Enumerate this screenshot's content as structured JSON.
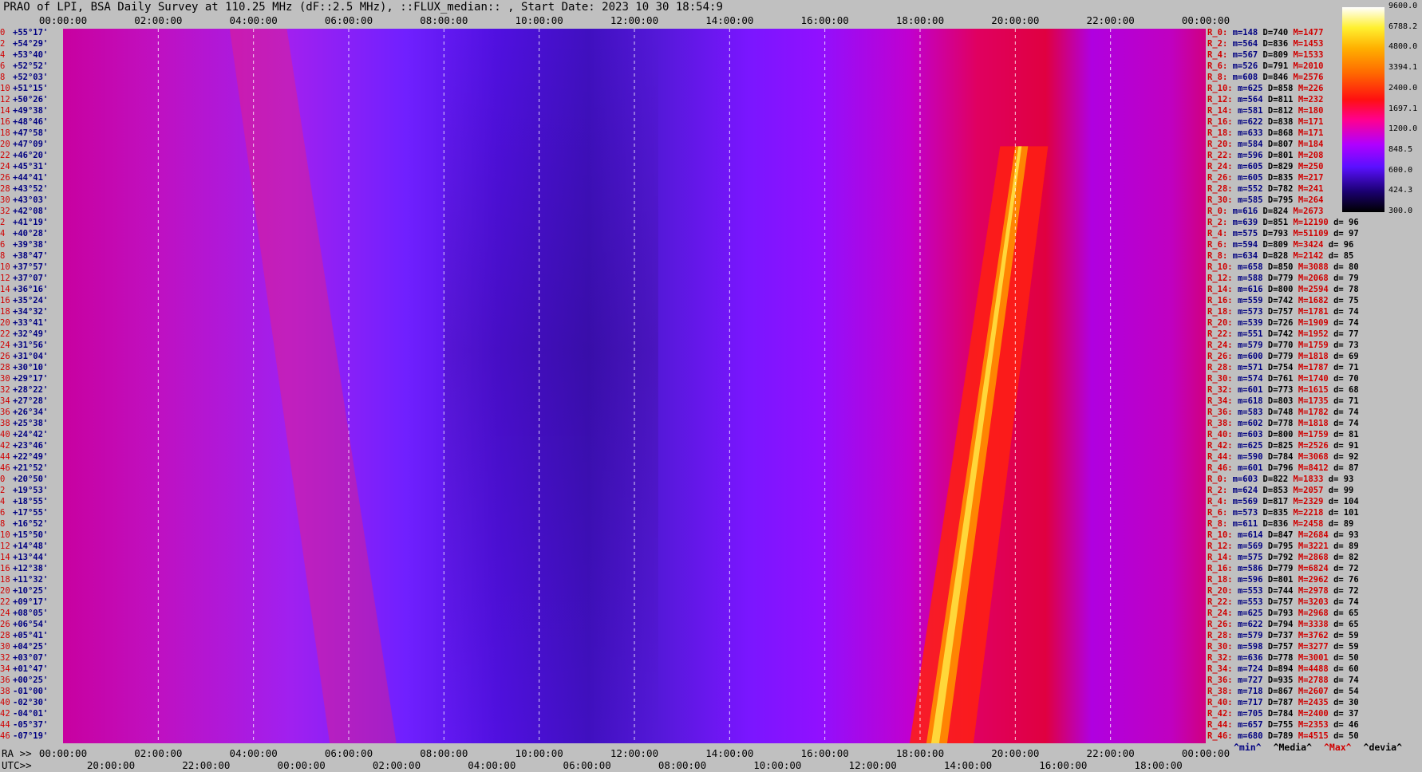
{
  "title": "PRAO of LPI, BSA Daily Survey at 110.25 MHz (dF::2.5 MHz), ::FLUX_median:: , Start Date: 2023 10 30 18:54:9",
  "bottom_prefix_1": "RA >>",
  "bottom_prefix_2": "UTC>>",
  "legend": {
    "min": "^min^",
    "media": "^Media^",
    "max": "^Max^",
    "devia": "^devia^"
  },
  "colors": {
    "min": "#000080",
    "media": "#000000",
    "max": "#d00000",
    "devia": "#000000"
  },
  "colorbar_labels": [
    "9600.0",
    "6788.2",
    "4800.0",
    "3394.1",
    "2400.0",
    "1697.1",
    "1200.0",
    "848.5",
    "600.0",
    "424.3",
    "300.0"
  ],
  "dec_labels": [
    {
      "i": "0",
      "v": "+55°17'"
    },
    {
      "i": "2",
      "v": "+54°29'"
    },
    {
      "i": "4",
      "v": "+53°40'"
    },
    {
      "i": "6",
      "v": "+52°52'"
    },
    {
      "i": "8",
      "v": "+52°03'"
    },
    {
      "i": "10",
      "v": "+51°15'"
    },
    {
      "i": "12",
      "v": "+50°26'"
    },
    {
      "i": "14",
      "v": "+49°38'"
    },
    {
      "i": "16",
      "v": "+48°46'"
    },
    {
      "i": "18",
      "v": "+47°58'"
    },
    {
      "i": "20",
      "v": "+47°09'"
    },
    {
      "i": "22",
      "v": "+46°20'"
    },
    {
      "i": "24",
      "v": "+45°31'"
    },
    {
      "i": "26",
      "v": "+44°41'"
    },
    {
      "i": "28",
      "v": "+43°52'"
    },
    {
      "i": "30",
      "v": "+43°03'"
    },
    {
      "i": "32",
      "v": "+42°08'"
    },
    {
      "i": "2",
      "v": "+41°19'"
    },
    {
      "i": "4",
      "v": "+40°28'"
    },
    {
      "i": "6",
      "v": "+39°38'"
    },
    {
      "i": "8",
      "v": "+38°47'"
    },
    {
      "i": "10",
      "v": "+37°57'"
    },
    {
      "i": "12",
      "v": "+37°07'"
    },
    {
      "i": "14",
      "v": "+36°16'"
    },
    {
      "i": "16",
      "v": "+35°24'"
    },
    {
      "i": "18",
      "v": "+34°32'"
    },
    {
      "i": "20",
      "v": "+33°41'"
    },
    {
      "i": "22",
      "v": "+32°49'"
    },
    {
      "i": "24",
      "v": "+31°56'"
    },
    {
      "i": "26",
      "v": "+31°04'"
    },
    {
      "i": "28",
      "v": "+30°10'"
    },
    {
      "i": "30",
      "v": "+29°17'"
    },
    {
      "i": "32",
      "v": "+28°22'"
    },
    {
      "i": "34",
      "v": "+27°28'"
    },
    {
      "i": "36",
      "v": "+26°34'"
    },
    {
      "i": "38",
      "v": "+25°38'"
    },
    {
      "i": "40",
      "v": "+24°42'"
    },
    {
      "i": "42",
      "v": "+23°46'"
    },
    {
      "i": "44",
      "v": "+22°49'"
    },
    {
      "i": "46",
      "v": "+21°52'"
    },
    {
      "i": "0",
      "v": "+20°50'"
    },
    {
      "i": "2",
      "v": "+19°53'"
    },
    {
      "i": "4",
      "v": "+18°55'"
    },
    {
      "i": "6",
      "v": "+17°55'"
    },
    {
      "i": "8",
      "v": "+16°52'"
    },
    {
      "i": "10",
      "v": "+15°50'"
    },
    {
      "i": "12",
      "v": "+14°48'"
    },
    {
      "i": "14",
      "v": "+13°44'"
    },
    {
      "i": "16",
      "v": "+12°38'"
    },
    {
      "i": "18",
      "v": "+11°32'"
    },
    {
      "i": "20",
      "v": "+10°25'"
    },
    {
      "i": "22",
      "v": "+09°17'"
    },
    {
      "i": "24",
      "v": "+08°05'"
    },
    {
      "i": "26",
      "v": "+06°54'"
    },
    {
      "i": "28",
      "v": "+05°41'"
    },
    {
      "i": "30",
      "v": "+04°25'"
    },
    {
      "i": "32",
      "v": "+03°07'"
    },
    {
      "i": "34",
      "v": "+01°47'"
    },
    {
      "i": "36",
      "v": "+00°25'"
    },
    {
      "i": "38",
      "v": "-01°00'"
    },
    {
      "i": "40",
      "v": "-02°30'"
    },
    {
      "i": "42",
      "v": "-04°01'"
    },
    {
      "i": "44",
      "v": "-05°37'"
    },
    {
      "i": "46",
      "v": "-07°19'"
    }
  ],
  "row_stats": [
    [
      "R_0:",
      "m=148",
      "D=740",
      "M=1477",
      ""
    ],
    [
      "R_2:",
      "m=564",
      "D=836",
      "M=1453",
      ""
    ],
    [
      "R_4:",
      "m=567",
      "D=809",
      "M=1533",
      ""
    ],
    [
      "R_6:",
      "m=526",
      "D=791",
      "M=2010",
      ""
    ],
    [
      "R_8:",
      "m=608",
      "D=846",
      "M=2576",
      ""
    ],
    [
      "R_10:",
      "m=625",
      "D=858",
      "M=226",
      ""
    ],
    [
      "R_12:",
      "m=564",
      "D=811",
      "M=232",
      ""
    ],
    [
      "R_14:",
      "m=581",
      "D=812",
      "M=180",
      ""
    ],
    [
      "R_16:",
      "m=622",
      "D=838",
      "M=171",
      ""
    ],
    [
      "R_18:",
      "m=633",
      "D=868",
      "M=171",
      ""
    ],
    [
      "R_20:",
      "m=584",
      "D=807",
      "M=184",
      ""
    ],
    [
      "R_22:",
      "m=596",
      "D=801",
      "M=208",
      ""
    ],
    [
      "R_24:",
      "m=605",
      "D=829",
      "M=250",
      ""
    ],
    [
      "R_26:",
      "m=605",
      "D=835",
      "M=217",
      ""
    ],
    [
      "R_28:",
      "m=552",
      "D=782",
      "M=241",
      ""
    ],
    [
      "R_30:",
      "m=585",
      "D=795",
      "M=264",
      ""
    ],
    [
      "R_0:",
      "m=616",
      "D=824",
      "M=2673",
      ""
    ],
    [
      "R_2:",
      "m=639",
      "D=851",
      "M=12190",
      "d= 96"
    ],
    [
      "R_4:",
      "m=575",
      "D=793",
      "M=51109",
      "d= 97"
    ],
    [
      "R_6:",
      "m=594",
      "D=809",
      "M=3424",
      "d= 96"
    ],
    [
      "R_8:",
      "m=634",
      "D=828",
      "M=2142",
      "d= 85"
    ],
    [
      "R_10:",
      "m=658",
      "D=850",
      "M=3088",
      "d= 80"
    ],
    [
      "R_12:",
      "m=588",
      "D=779",
      "M=2068",
      "d= 79"
    ],
    [
      "R_14:",
      "m=616",
      "D=800",
      "M=2594",
      "d= 78"
    ],
    [
      "R_16:",
      "m=559",
      "D=742",
      "M=1682",
      "d= 75"
    ],
    [
      "R_18:",
      "m=573",
      "D=757",
      "M=1781",
      "d= 74"
    ],
    [
      "R_20:",
      "m=539",
      "D=726",
      "M=1909",
      "d= 74"
    ],
    [
      "R_22:",
      "m=551",
      "D=742",
      "M=1952",
      "d= 77"
    ],
    [
      "R_24:",
      "m=579",
      "D=770",
      "M=1759",
      "d= 73"
    ],
    [
      "R_26:",
      "m=600",
      "D=779",
      "M=1818",
      "d= 69"
    ],
    [
      "R_28:",
      "m=571",
      "D=754",
      "M=1787",
      "d= 71"
    ],
    [
      "R_30:",
      "m=574",
      "D=761",
      "M=1740",
      "d= 70"
    ],
    [
      "R_32:",
      "m=601",
      "D=773",
      "M=1615",
      "d= 68"
    ],
    [
      "R_34:",
      "m=618",
      "D=803",
      "M=1735",
      "d= 71"
    ],
    [
      "R_36:",
      "m=583",
      "D=748",
      "M=1782",
      "d= 74"
    ],
    [
      "R_38:",
      "m=602",
      "D=778",
      "M=1818",
      "d= 74"
    ],
    [
      "R_40:",
      "m=603",
      "D=800",
      "M=1759",
      "d= 81"
    ],
    [
      "R_42:",
      "m=625",
      "D=825",
      "M=2526",
      "d= 91"
    ],
    [
      "R_44:",
      "m=590",
      "D=784",
      "M=3068",
      "d= 92"
    ],
    [
      "R_46:",
      "m=601",
      "D=796",
      "M=8412",
      "d= 87"
    ],
    [
      "R_0:",
      "m=603",
      "D=822",
      "M=1833",
      "d= 93"
    ],
    [
      "R_2:",
      "m=624",
      "D=853",
      "M=2057",
      "d= 99"
    ],
    [
      "R_4:",
      "m=569",
      "D=817",
      "M=2329",
      "d= 104"
    ],
    [
      "R_6:",
      "m=573",
      "D=835",
      "M=2218",
      "d= 101"
    ],
    [
      "R_8:",
      "m=611",
      "D=836",
      "M=2458",
      "d= 89"
    ],
    [
      "R_10:",
      "m=614",
      "D=847",
      "M=2684",
      "d= 93"
    ],
    [
      "R_12:",
      "m=569",
      "D=795",
      "M=3221",
      "d= 89"
    ],
    [
      "R_14:",
      "m=575",
      "D=792",
      "M=2868",
      "d= 82"
    ],
    [
      "R_16:",
      "m=586",
      "D=779",
      "M=6824",
      "d= 72"
    ],
    [
      "R_18:",
      "m=596",
      "D=801",
      "M=2962",
      "d= 76"
    ],
    [
      "R_20:",
      "m=553",
      "D=744",
      "M=2978",
      "d= 72"
    ],
    [
      "R_22:",
      "m=553",
      "D=757",
      "M=3203",
      "d= 74"
    ],
    [
      "R_24:",
      "m=625",
      "D=793",
      "M=2968",
      "d= 65"
    ],
    [
      "R_26:",
      "m=622",
      "D=794",
      "M=3338",
      "d= 65"
    ],
    [
      "R_28:",
      "m=579",
      "D=737",
      "M=3762",
      "d= 59"
    ],
    [
      "R_30:",
      "m=598",
      "D=757",
      "M=3277",
      "d= 59"
    ],
    [
      "R_32:",
      "m=636",
      "D=778",
      "M=3001",
      "d= 50"
    ],
    [
      "R_34:",
      "m=724",
      "D=894",
      "M=4488",
      "d= 60"
    ],
    [
      "R_36:",
      "m=727",
      "D=935",
      "M=2788",
      "d= 74"
    ],
    [
      "R_38:",
      "m=718",
      "D=867",
      "M=2607",
      "d= 54"
    ],
    [
      "R_40:",
      "m=717",
      "D=787",
      "M=2435",
      "d= 30"
    ],
    [
      "R_42:",
      "m=705",
      "D=784",
      "M=2400",
      "d= 37"
    ],
    [
      "R_44:",
      "m=657",
      "D=755",
      "M=2353",
      "d= 46"
    ],
    [
      "R_46:",
      "m=680",
      "D=789",
      "M=4515",
      "d= 50"
    ]
  ],
  "chart_data": {
    "type": "heatmap",
    "title": "PRAO of LPI, BSA Daily Survey at 110.25 MHz (dF::2.5 MHz), ::FLUX_median:: , Start Date: 2023 10 30 18:54:9",
    "x_top_ticks": [
      "00:00:00",
      "02:00:00",
      "04:00:00",
      "06:00:00",
      "08:00:00",
      "10:00:00",
      "12:00:00",
      "14:00:00",
      "16:00:00",
      "18:00:00",
      "20:00:00",
      "22:00:00",
      "00:00:00"
    ],
    "x_ra_ticks": [
      "00:00:00",
      "02:00:00",
      "04:00:00",
      "06:00:00",
      "08:00:00",
      "10:00:00",
      "12:00:00",
      "14:00:00",
      "16:00:00",
      "18:00:00",
      "20:00:00",
      "22:00:00",
      "00:00:00"
    ],
    "x_utc_ticks": [
      "20:00:00",
      "22:00:00",
      "00:00:00",
      "02:00:00",
      "04:00:00",
      "06:00:00",
      "08:00:00",
      "10:00:00",
      "12:00:00",
      "14:00:00",
      "16:00:00",
      "18:00:00"
    ],
    "x_range_hours": [
      0,
      24
    ],
    "y_axis": "declination",
    "colorscale": [
      300.0,
      424.3,
      600.0,
      848.5,
      1200.0,
      1697.1,
      2400.0,
      3394.1,
      4800.0,
      6788.2,
      9600.0
    ],
    "grid": "vertical dashed lines every 2 h",
    "features": [
      {
        "name": "bright ridge",
        "ra_start_h": 18.2,
        "ra_end_h": 20.1,
        "dec_start": -7.3,
        "dec_end": 45.0
      },
      {
        "name": "faint band",
        "ra_start_h": 3.5,
        "ra_end_h": 7.0,
        "dec_start": 55.3,
        "dec_end": -7.3
      },
      {
        "name": "cold region",
        "ra_start_h": 8.0,
        "ra_end_h": 12.0
      }
    ]
  }
}
